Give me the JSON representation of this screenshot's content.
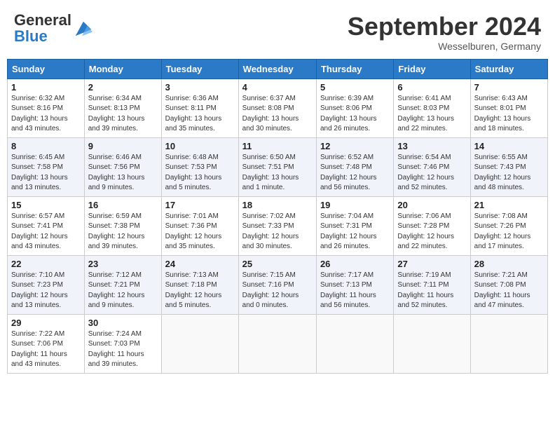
{
  "header": {
    "logo_general": "General",
    "logo_blue": "Blue",
    "month_title": "September 2024",
    "location": "Wesselburen, Germany"
  },
  "days_of_week": [
    "Sunday",
    "Monday",
    "Tuesday",
    "Wednesday",
    "Thursday",
    "Friday",
    "Saturday"
  ],
  "weeks": [
    [
      {
        "day": "1",
        "info": "Sunrise: 6:32 AM\nSunset: 8:16 PM\nDaylight: 13 hours\nand 43 minutes."
      },
      {
        "day": "2",
        "info": "Sunrise: 6:34 AM\nSunset: 8:13 PM\nDaylight: 13 hours\nand 39 minutes."
      },
      {
        "day": "3",
        "info": "Sunrise: 6:36 AM\nSunset: 8:11 PM\nDaylight: 13 hours\nand 35 minutes."
      },
      {
        "day": "4",
        "info": "Sunrise: 6:37 AM\nSunset: 8:08 PM\nDaylight: 13 hours\nand 30 minutes."
      },
      {
        "day": "5",
        "info": "Sunrise: 6:39 AM\nSunset: 8:06 PM\nDaylight: 13 hours\nand 26 minutes."
      },
      {
        "day": "6",
        "info": "Sunrise: 6:41 AM\nSunset: 8:03 PM\nDaylight: 13 hours\nand 22 minutes."
      },
      {
        "day": "7",
        "info": "Sunrise: 6:43 AM\nSunset: 8:01 PM\nDaylight: 13 hours\nand 18 minutes."
      }
    ],
    [
      {
        "day": "8",
        "info": "Sunrise: 6:45 AM\nSunset: 7:58 PM\nDaylight: 13 hours\nand 13 minutes."
      },
      {
        "day": "9",
        "info": "Sunrise: 6:46 AM\nSunset: 7:56 PM\nDaylight: 13 hours\nand 9 minutes."
      },
      {
        "day": "10",
        "info": "Sunrise: 6:48 AM\nSunset: 7:53 PM\nDaylight: 13 hours\nand 5 minutes."
      },
      {
        "day": "11",
        "info": "Sunrise: 6:50 AM\nSunset: 7:51 PM\nDaylight: 13 hours\nand 1 minute."
      },
      {
        "day": "12",
        "info": "Sunrise: 6:52 AM\nSunset: 7:48 PM\nDaylight: 12 hours\nand 56 minutes."
      },
      {
        "day": "13",
        "info": "Sunrise: 6:54 AM\nSunset: 7:46 PM\nDaylight: 12 hours\nand 52 minutes."
      },
      {
        "day": "14",
        "info": "Sunrise: 6:55 AM\nSunset: 7:43 PM\nDaylight: 12 hours\nand 48 minutes."
      }
    ],
    [
      {
        "day": "15",
        "info": "Sunrise: 6:57 AM\nSunset: 7:41 PM\nDaylight: 12 hours\nand 43 minutes."
      },
      {
        "day": "16",
        "info": "Sunrise: 6:59 AM\nSunset: 7:38 PM\nDaylight: 12 hours\nand 39 minutes."
      },
      {
        "day": "17",
        "info": "Sunrise: 7:01 AM\nSunset: 7:36 PM\nDaylight: 12 hours\nand 35 minutes."
      },
      {
        "day": "18",
        "info": "Sunrise: 7:02 AM\nSunset: 7:33 PM\nDaylight: 12 hours\nand 30 minutes."
      },
      {
        "day": "19",
        "info": "Sunrise: 7:04 AM\nSunset: 7:31 PM\nDaylight: 12 hours\nand 26 minutes."
      },
      {
        "day": "20",
        "info": "Sunrise: 7:06 AM\nSunset: 7:28 PM\nDaylight: 12 hours\nand 22 minutes."
      },
      {
        "day": "21",
        "info": "Sunrise: 7:08 AM\nSunset: 7:26 PM\nDaylight: 12 hours\nand 17 minutes."
      }
    ],
    [
      {
        "day": "22",
        "info": "Sunrise: 7:10 AM\nSunset: 7:23 PM\nDaylight: 12 hours\nand 13 minutes."
      },
      {
        "day": "23",
        "info": "Sunrise: 7:12 AM\nSunset: 7:21 PM\nDaylight: 12 hours\nand 9 minutes."
      },
      {
        "day": "24",
        "info": "Sunrise: 7:13 AM\nSunset: 7:18 PM\nDaylight: 12 hours\nand 5 minutes."
      },
      {
        "day": "25",
        "info": "Sunrise: 7:15 AM\nSunset: 7:16 PM\nDaylight: 12 hours\nand 0 minutes."
      },
      {
        "day": "26",
        "info": "Sunrise: 7:17 AM\nSunset: 7:13 PM\nDaylight: 11 hours\nand 56 minutes."
      },
      {
        "day": "27",
        "info": "Sunrise: 7:19 AM\nSunset: 7:11 PM\nDaylight: 11 hours\nand 52 minutes."
      },
      {
        "day": "28",
        "info": "Sunrise: 7:21 AM\nSunset: 7:08 PM\nDaylight: 11 hours\nand 47 minutes."
      }
    ],
    [
      {
        "day": "29",
        "info": "Sunrise: 7:22 AM\nSunset: 7:06 PM\nDaylight: 11 hours\nand 43 minutes."
      },
      {
        "day": "30",
        "info": "Sunrise: 7:24 AM\nSunset: 7:03 PM\nDaylight: 11 hours\nand 39 minutes."
      },
      {
        "day": "",
        "info": ""
      },
      {
        "day": "",
        "info": ""
      },
      {
        "day": "",
        "info": ""
      },
      {
        "day": "",
        "info": ""
      },
      {
        "day": "",
        "info": ""
      }
    ]
  ]
}
